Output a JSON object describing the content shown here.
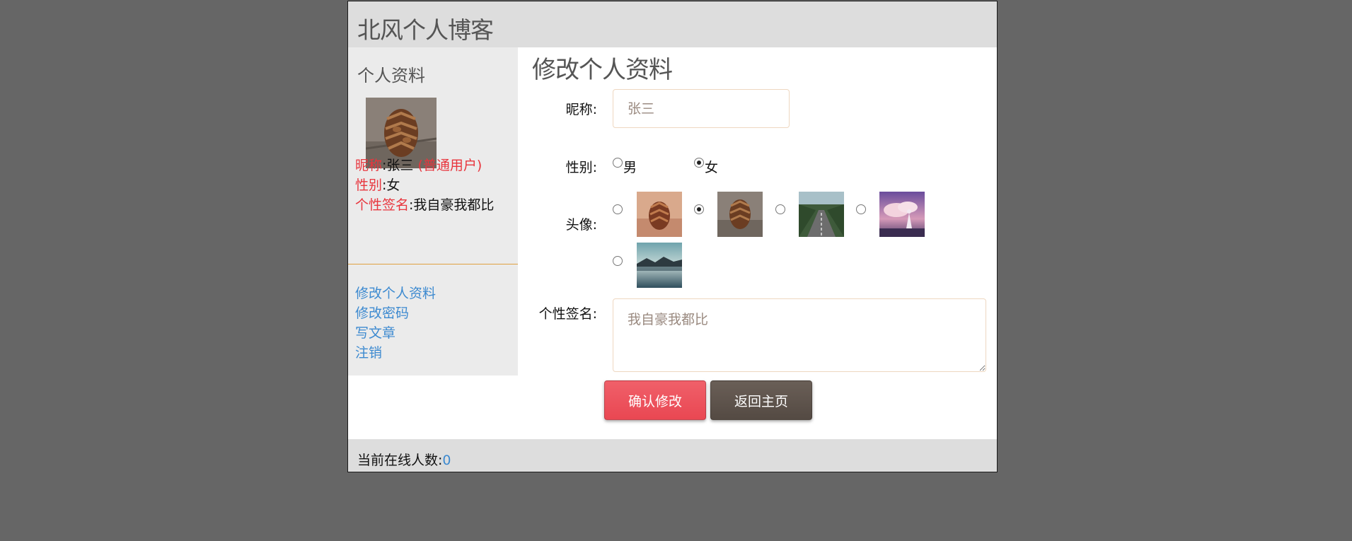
{
  "site": {
    "title": "北风个人博客"
  },
  "sidebar": {
    "title": "个人资料",
    "avatar_icon": "pinecone-avatar-image",
    "profile": {
      "nickname_label": "昵称",
      "nickname_value": ":张三",
      "role": " (普通用户)",
      "gender_label": "性别",
      "gender_value": ":女",
      "signature_label": "个性签名",
      "signature_value": ":我自豪我都比"
    },
    "links": [
      {
        "label": "修改个人资料"
      },
      {
        "label": "修改密码"
      },
      {
        "label": "写文章"
      },
      {
        "label": "注销"
      }
    ]
  },
  "main": {
    "title": "修改个人资料",
    "form": {
      "nickname_label": "昵称:",
      "nickname_placeholder": "张三",
      "gender_label": "性别:",
      "gender_options": [
        {
          "label": "男",
          "checked": false
        },
        {
          "label": "女",
          "checked": true
        }
      ],
      "avatar_label": "头像:",
      "avatar_options": [
        {
          "icon": "pinecone-on-sand-image",
          "checked": false
        },
        {
          "icon": "pinecone-on-ground-image",
          "checked": true
        },
        {
          "icon": "forest-road-image",
          "checked": false
        },
        {
          "icon": "anime-girl-sky-image",
          "checked": false
        },
        {
          "icon": "mountain-lake-image",
          "checked": false
        }
      ],
      "signature_label": "个性签名:",
      "signature_placeholder": "我自豪我都比"
    },
    "buttons": {
      "confirm_label": "确认修改",
      "back_label": "返回主页"
    }
  },
  "footer": {
    "online_label": "当前在线人数:",
    "online_count": "0"
  },
  "colors": {
    "background": "#666666",
    "header_bg": "#dddddd",
    "sidebar_bg": "#ebebeb",
    "accent_red": "#e8353d",
    "link_blue": "#3d8ad0",
    "confirm_button": "#e94752",
    "back_button": "#544a43"
  }
}
